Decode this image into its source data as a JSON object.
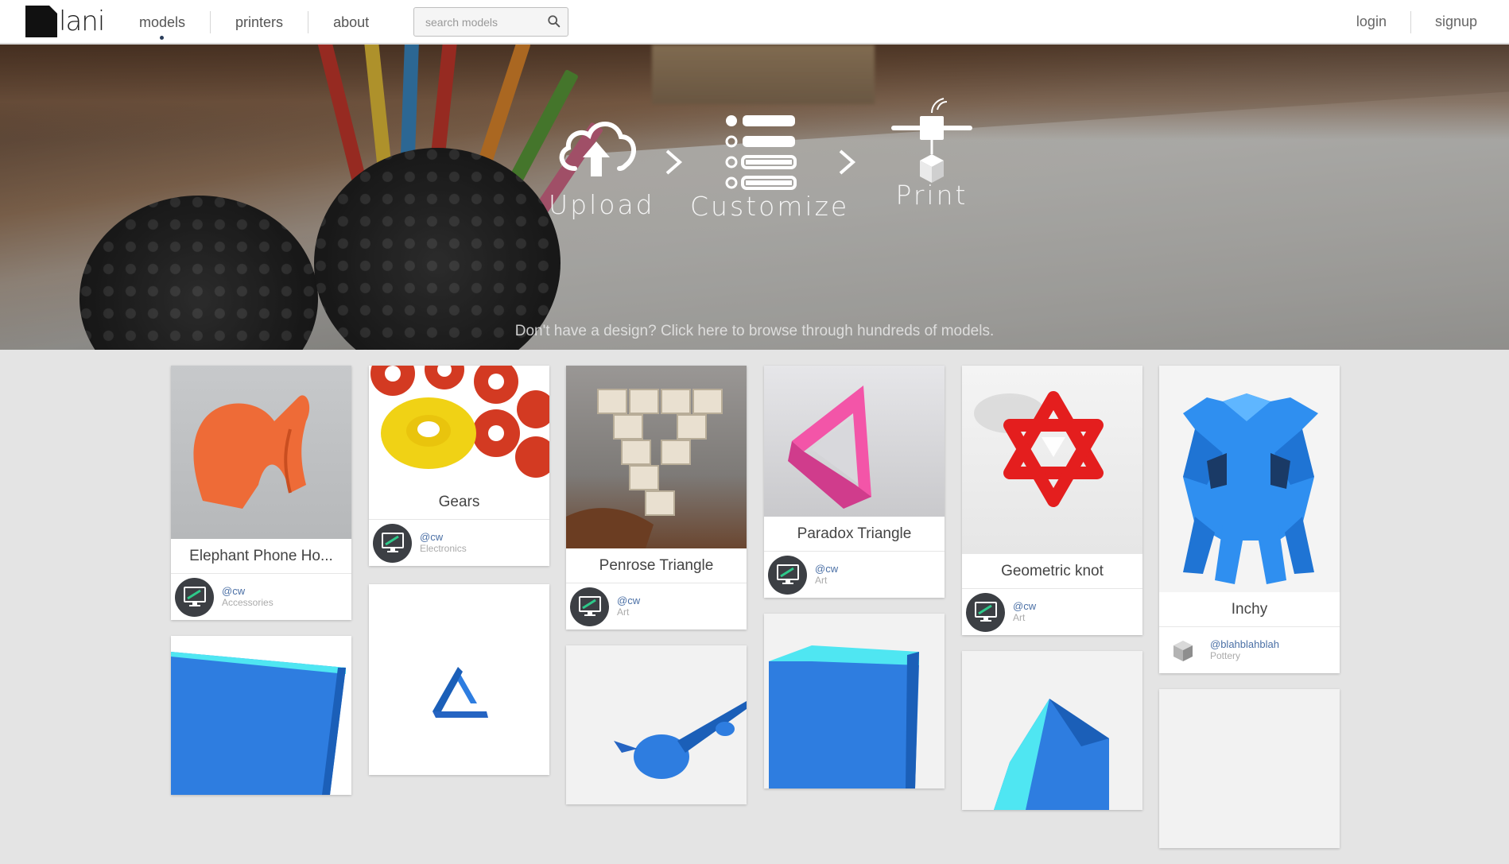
{
  "logo": {
    "text": "lani"
  },
  "nav": {
    "items": [
      {
        "label": "models"
      },
      {
        "label": "printers"
      },
      {
        "label": "about"
      }
    ]
  },
  "search": {
    "placeholder": "search models"
  },
  "auth": {
    "login": "login",
    "signup": "signup"
  },
  "hero": {
    "steps": [
      {
        "label": "Upload"
      },
      {
        "label": "Customize"
      },
      {
        "label": "Print"
      }
    ],
    "subtitle": "Don't have a design? Click here to browse through hundreds of models."
  },
  "cards": [
    {
      "title": "Elephant Phone Ho...",
      "user": "@cw",
      "category": "Accessories"
    },
    {
      "title": "Gears",
      "user": "@cw",
      "category": "Electronics"
    },
    {
      "title": "Penrose Triangle",
      "user": "@cw",
      "category": "Art"
    },
    {
      "title": "Paradox Triangle",
      "user": "@cw",
      "category": "Art"
    },
    {
      "title": "Geometric knot",
      "user": "@cw",
      "category": "Art"
    },
    {
      "title": "Inchy",
      "user": "@blahblahblah",
      "category": "Pottery"
    }
  ],
  "colors": {
    "accent": "#4a6fa5",
    "avatar_bg": "#3c3f44",
    "page_bg": "#e4e4e4"
  }
}
